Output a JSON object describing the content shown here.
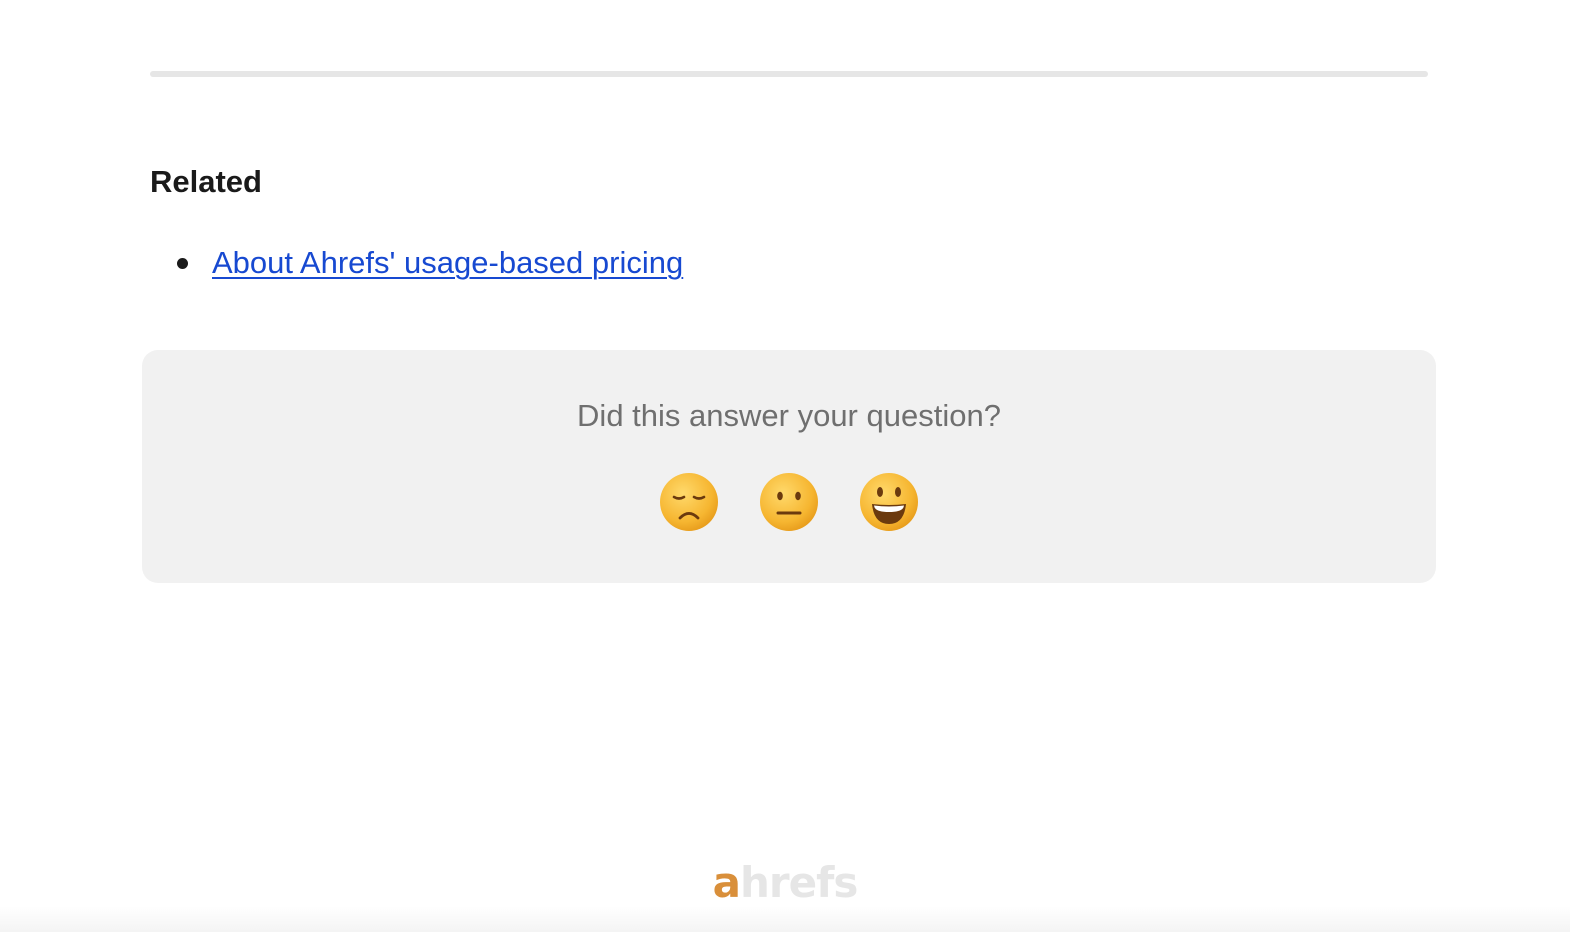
{
  "related": {
    "heading": "Related",
    "items": [
      {
        "label": "About Ahrefs' usage-based pricing"
      }
    ]
  },
  "feedback": {
    "question": "Did this answer your question?",
    "reactions": [
      {
        "name": "disappointed-face-icon",
        "label": "Disappointed"
      },
      {
        "name": "neutral-face-icon",
        "label": "Neutral"
      },
      {
        "name": "smiley-face-icon",
        "label": "Smiley"
      }
    ]
  },
  "footer": {
    "logo_first": "a",
    "logo_rest": "hrefs"
  },
  "colors": {
    "link": "#1749d1",
    "feedback_background": "#f1f1f1",
    "logo_accent": "#d98f3a",
    "logo_muted": "#e6e6e6"
  }
}
